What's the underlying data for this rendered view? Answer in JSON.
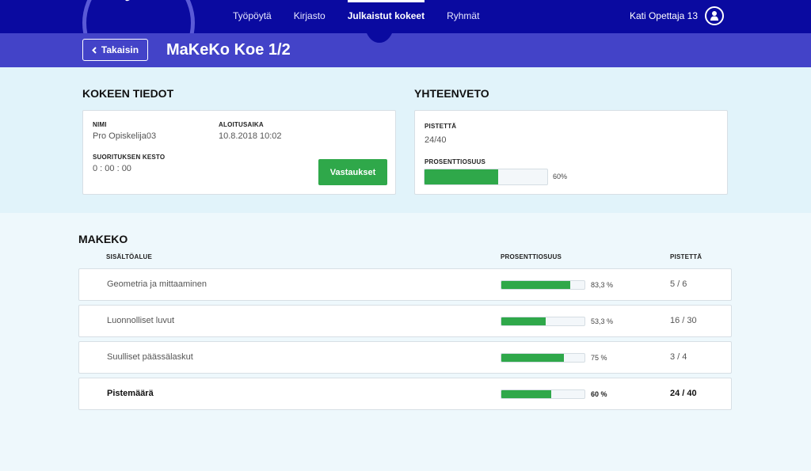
{
  "nav": {
    "items": [
      {
        "label": "Työpöytä",
        "active": false
      },
      {
        "label": "Kirjasto",
        "active": false
      },
      {
        "label": "Julkaistut kokeet",
        "active": true
      },
      {
        "label": "Ryhmät",
        "active": false
      }
    ],
    "user_name": "Kati Opettaja 13"
  },
  "header": {
    "back_label": "Takaisin",
    "title": "MaKeKo Koe 1/2"
  },
  "details": {
    "section_title": "KOKEEN TIEDOT",
    "name_label": "NIMI",
    "name_value": "Pro Opiskelija03",
    "start_label": "ALOITUSAIKA",
    "start_value": "10.8.2018 10:02",
    "duration_label": "SUORITUKSEN KESTO",
    "duration_value": "0 : 00 : 00",
    "answers_button": "Vastaukset"
  },
  "summary": {
    "section_title": "YHTEENVETO",
    "points_label": "PISTETTÄ",
    "points_value": "24/40",
    "percent_label": "PROSENTTIOSUUS",
    "percent_text": "60%",
    "percent_fraction": 0.6
  },
  "results": {
    "section_title": "MAKEKO",
    "headers": {
      "area": "SISÄLTÖALUE",
      "percent": "PROSENTTIOSUUS",
      "points": "PISTETTÄ"
    },
    "rows": [
      {
        "name": "Geometria ja mittaaminen",
        "percent_text": "83,3 %",
        "fraction": 0.833,
        "points": "5 / 6"
      },
      {
        "name": "Luonnolliset luvut",
        "percent_text": "53,3 %",
        "fraction": 0.533,
        "points": "16 / 30"
      },
      {
        "name": "Suulliset päässälaskut",
        "percent_text": "75 %",
        "fraction": 0.75,
        "points": "3 / 4"
      }
    ],
    "total": {
      "name": "Pistemäärä",
      "percent_text": "60 %",
      "fraction": 0.6,
      "points": "24 / 40"
    }
  },
  "colors": {
    "nav": "#0a0aa0",
    "subheader": "#4343c8",
    "accent_green": "#2fa84a"
  }
}
